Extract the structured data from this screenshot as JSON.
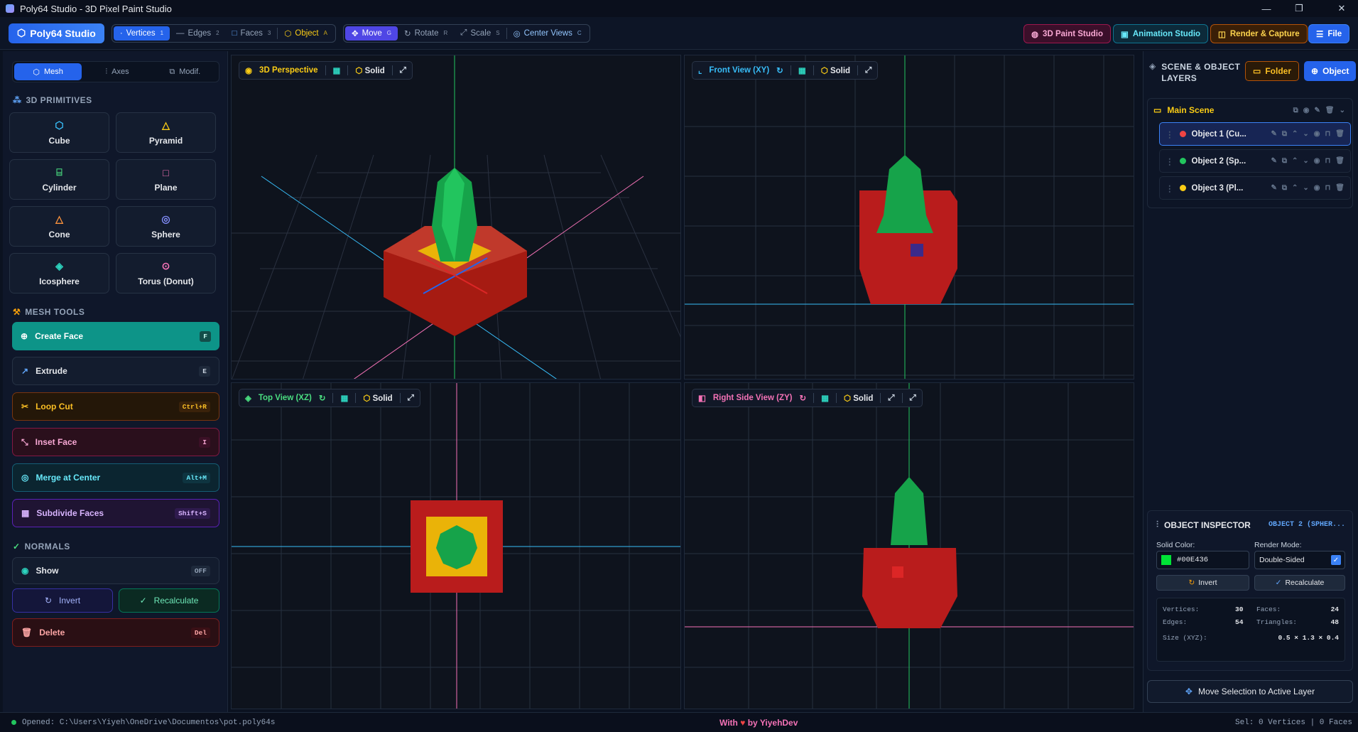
{
  "window": {
    "title": "Poly64 Studio - 3D Pixel Paint Studio"
  },
  "toolbar": {
    "brand": "Poly64 Studio",
    "select_modes": [
      {
        "label": "Vertices",
        "key": "1"
      },
      {
        "label": "Edges",
        "key": "2"
      },
      {
        "label": "Faces",
        "key": "3"
      },
      {
        "label": "Object",
        "key": "A"
      }
    ],
    "transforms": [
      {
        "label": "Move",
        "key": "G"
      },
      {
        "label": "Rotate",
        "key": "R"
      },
      {
        "label": "Scale",
        "key": "S"
      },
      {
        "label": "Center Views",
        "key": "C"
      }
    ],
    "paint_studio": "3D Paint Studio",
    "animation_studio": "Animation Studio",
    "render_capture": "Render & Capture",
    "file": "File"
  },
  "left": {
    "tabs": [
      "Mesh",
      "Axes",
      "Modif."
    ],
    "primitives_title": "3D PRIMITIVES",
    "primitives": [
      "Cube",
      "Pyramid",
      "Cylinder",
      "Plane",
      "Cone",
      "Sphere",
      "Icosphere",
      "Torus (Donut)"
    ],
    "mesh_tools_title": "MESH TOOLS",
    "tools": [
      {
        "label": "Create Face",
        "key": "F"
      },
      {
        "label": "Extrude",
        "key": "E"
      },
      {
        "label": "Loop Cut",
        "key": "Ctrl+R"
      },
      {
        "label": "Inset Face",
        "key": "I"
      },
      {
        "label": "Merge at Center",
        "key": "Alt+M"
      },
      {
        "label": "Subdivide Faces",
        "key": "Shift+S"
      }
    ],
    "normals_title": "NORMALS",
    "show_label": "Show",
    "show_state": "OFF",
    "invert": "Invert",
    "recalculate": "Recalculate",
    "delete_label": "Delete",
    "delete_key": "Del"
  },
  "viewports": [
    {
      "title": "3D Perspective",
      "shading": "Solid"
    },
    {
      "title": "Front View (XY)",
      "shading": "Solid"
    },
    {
      "title": "Top View (XZ)",
      "shading": "Solid"
    },
    {
      "title": "Right Side View (ZY)",
      "shading": "Solid"
    }
  ],
  "right": {
    "title": "SCENE & OBJECT LAYERS",
    "folder_button": "Folder",
    "object_button": "Object",
    "scene_name": "Main Scene",
    "layers": [
      {
        "name": "Object 1 (Cu...",
        "color": "#ef4444"
      },
      {
        "name": "Object 2 (Sp...",
        "color": "#22c55e"
      },
      {
        "name": "Object 3 (Pl...",
        "color": "#facc15"
      }
    ],
    "inspector": {
      "title": "OBJECT INSPECTOR",
      "object_tag": "OBJECT 2 (SPHER...",
      "solid_color_label": "Solid Color:",
      "solid_color_value": "#00E436",
      "render_mode_label": "Render Mode:",
      "render_mode_value": "Double-Sided",
      "invert": "Invert",
      "recalculate": "Recalculate",
      "vertices_label": "Vertices:",
      "vertices": "30",
      "faces_label": "Faces:",
      "faces": "24",
      "edges_label": "Edges:",
      "edges": "54",
      "triangles_label": "Triangles:",
      "triangles": "48",
      "size_label": "Size (XYZ):",
      "size": "0.5 × 1.3 × 0.4"
    },
    "move_selection": "Move Selection to Active Layer"
  },
  "status": {
    "opened": "Opened: C:\\Users\\Yiyeh\\OneDrive\\Documentos\\pot.poly64s",
    "credit_prefix": "With",
    "credit_suffix": "by YiyehDev",
    "selection": "Sel: 0 Vertices | 0 Faces"
  }
}
